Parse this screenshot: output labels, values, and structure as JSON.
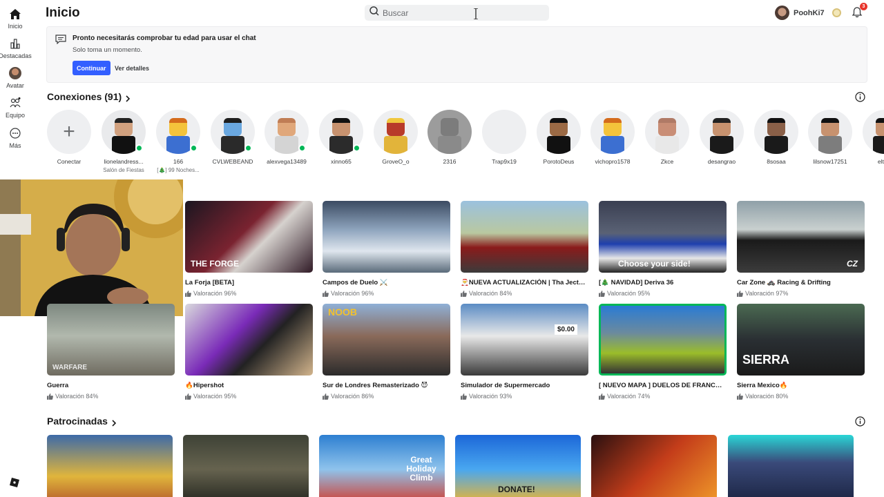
{
  "app": {
    "page_title": "Inicio"
  },
  "rail": [
    {
      "label": "Inicio",
      "icon": "home-icon"
    },
    {
      "label": "Destacadas",
      "icon": "charts-icon"
    },
    {
      "label": "Avatar",
      "icon": "avatar-icon"
    },
    {
      "label": "Equipo",
      "icon": "team-icon"
    },
    {
      "label": "Más",
      "icon": "more-icon"
    }
  ],
  "header": {
    "search_placeholder": "Buscar",
    "username": "PoohKi7",
    "notifications_count": "3"
  },
  "notice": {
    "title": "Pronto necesitarás comprobar tu edad para usar el chat",
    "subtitle": "Solo toma un momento.",
    "primary_button": "Continuar",
    "secondary_link": "Ver detalles"
  },
  "connections": {
    "title": "Conexiones (91)",
    "items": [
      {
        "name": "Conectar",
        "sub": ""
      },
      {
        "name": "lionelandress...",
        "sub": "Salón de Fiestas",
        "online": true
      },
      {
        "name": "166",
        "sub": "[🎄] 99 Noches...",
        "online": true
      },
      {
        "name": "CVLWEBEAND",
        "sub": "",
        "online": true
      },
      {
        "name": "alexvega13489",
        "sub": "",
        "online": true
      },
      {
        "name": "xinno65",
        "sub": "",
        "online": true
      },
      {
        "name": "GroveO_o",
        "sub": ""
      },
      {
        "name": "2316",
        "sub": ""
      },
      {
        "name": "Trap9x19",
        "sub": ""
      },
      {
        "name": "PorotoDeus",
        "sub": ""
      },
      {
        "name": "vichopro1578",
        "sub": ""
      },
      {
        "name": "Zkce",
        "sub": ""
      },
      {
        "name": "desangrao",
        "sub": ""
      },
      {
        "name": "8sosaa",
        "sub": ""
      },
      {
        "name": "lilsnow17251",
        "sub": ""
      },
      {
        "name": "eltula",
        "sub": ""
      }
    ]
  },
  "games_row1": [
    {
      "title": "La Forja [BETA]",
      "rating": "Valoración 96%",
      "thumb_text": "THE FORGE"
    },
    {
      "title": "Campos de Duelo ⚔️",
      "rating": "Valoración 96%",
      "thumb_text": ""
    },
    {
      "title": "🎅NUEVA ACTUALIZACIÓN | Tha Jects™",
      "rating": "Valoración 84%",
      "thumb_text": ""
    },
    {
      "title": "[🎄 NAVIDAD] Deriva 36",
      "rating": "Valoración 95%",
      "thumb_text": "Choose your side!"
    },
    {
      "title": "Car Zone 🚓 Racing & Drifting",
      "rating": "Valoración 97%",
      "thumb_text": "CZ"
    }
  ],
  "games_row2": [
    {
      "title": "Guerra",
      "rating": "Valoración 84%",
      "thumb_text": "WARFARE"
    },
    {
      "title": "🔥Hipershot",
      "rating": "Valoración 95%",
      "thumb_text": ""
    },
    {
      "title": "Sur de Londres Remasterizado 😈",
      "rating": "Valoración 86%",
      "thumb_text": "NOOB"
    },
    {
      "title": "Simulador de Supermercado",
      "rating": "Valoración 93%",
      "thumb_text": "$0.00"
    },
    {
      "title": "[ NUEVO MAPA ] DUELOS DE FRANCOTI...",
      "rating": "Valoración 74%",
      "thumb_text": ""
    },
    {
      "title": "Sierra Mexico🔥",
      "rating": "Valoración 80%",
      "thumb_text": "SIERRA"
    }
  ],
  "sponsored": {
    "title": "Patrocinadas",
    "tiles": [
      {
        "thumb_text": ""
      },
      {
        "thumb_text": ""
      },
      {
        "thumb_text": "Great Holiday Climb"
      },
      {
        "thumb_text": "DONATE!"
      },
      {
        "thumb_text": ""
      },
      {
        "thumb_text": ""
      }
    ]
  }
}
